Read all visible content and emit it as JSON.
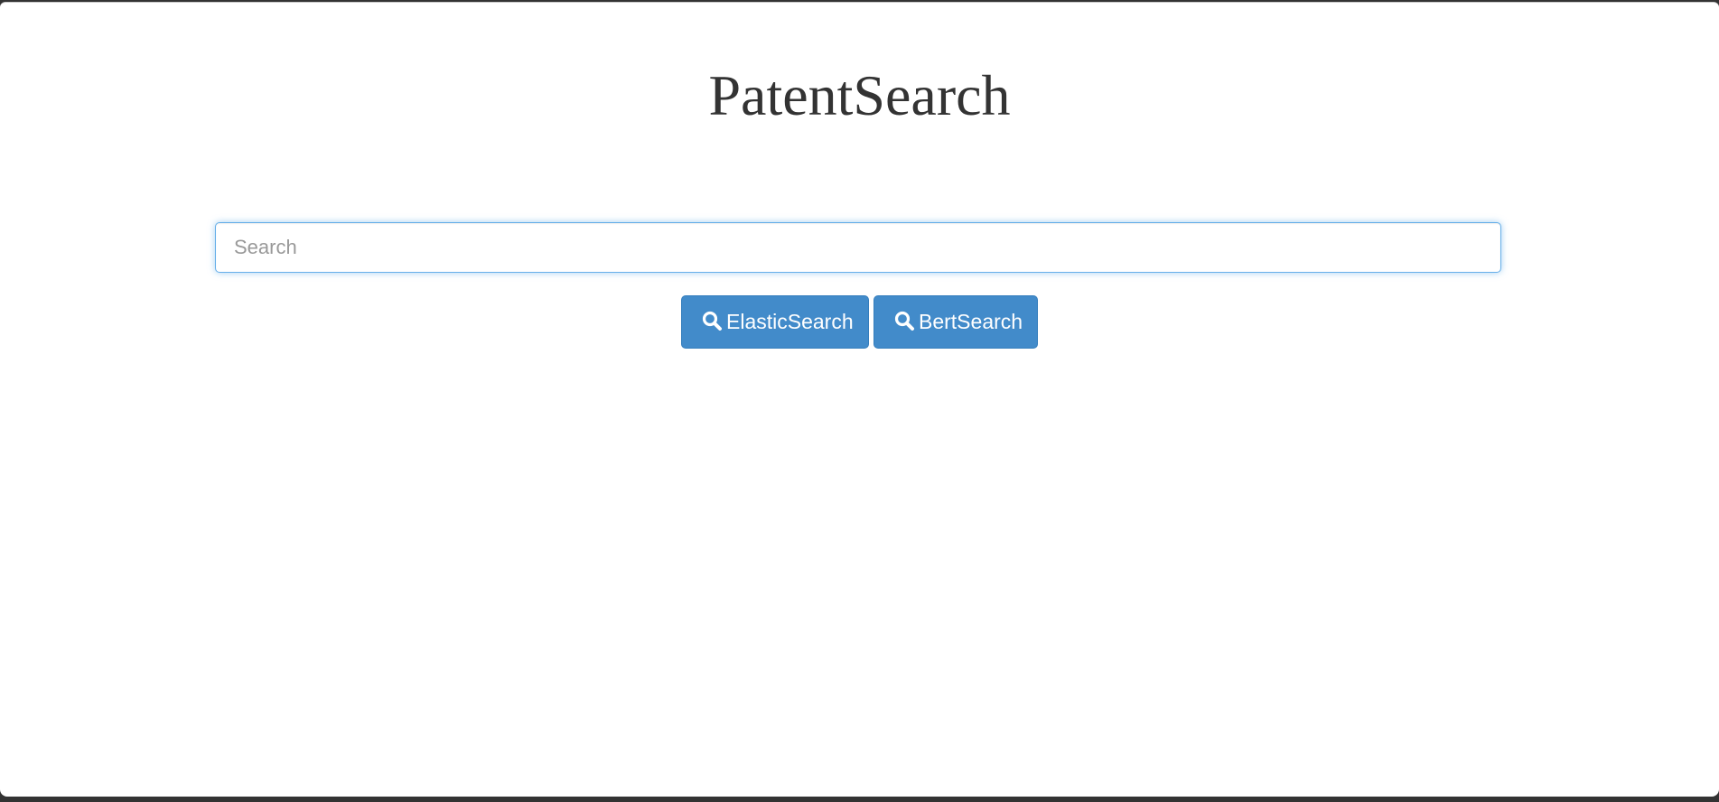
{
  "page": {
    "title": "PatentSearch"
  },
  "search": {
    "placeholder": "Search",
    "value": ""
  },
  "buttons": {
    "elastic_label": "ElasticSearch",
    "bert_label": "BertSearch",
    "icon": "search-icon",
    "color": "#428bca"
  }
}
